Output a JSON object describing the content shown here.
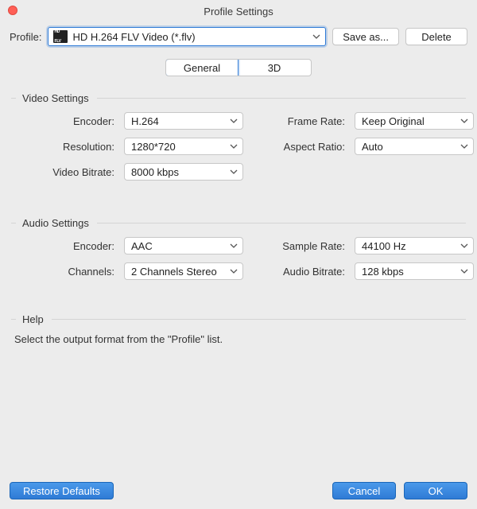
{
  "window": {
    "title": "Profile Settings"
  },
  "profile": {
    "label": "Profile:",
    "value": "HD H.264 FLV Video (*.flv)",
    "save_as": "Save as...",
    "delete": "Delete"
  },
  "tabs": {
    "general": "General",
    "threeD": "3D",
    "active": "general"
  },
  "video": {
    "section": "Video Settings",
    "encoder_label": "Encoder:",
    "encoder": "H.264",
    "framerate_label": "Frame Rate:",
    "framerate": "Keep Original",
    "resolution_label": "Resolution:",
    "resolution": "1280*720",
    "aspect_label": "Aspect Ratio:",
    "aspect": "Auto",
    "bitrate_label": "Video Bitrate:",
    "bitrate": "8000 kbps"
  },
  "audio": {
    "section": "Audio Settings",
    "encoder_label": "Encoder:",
    "encoder": "AAC",
    "samplerate_label": "Sample Rate:",
    "samplerate": "44100 Hz",
    "channels_label": "Channels:",
    "channels": "2 Channels Stereo",
    "bitrate_label": "Audio Bitrate:",
    "bitrate": "128 kbps"
  },
  "help": {
    "section": "Help",
    "text": "Select the output format from the \"Profile\" list."
  },
  "footer": {
    "restore": "Restore Defaults",
    "cancel": "Cancel",
    "ok": "OK"
  }
}
